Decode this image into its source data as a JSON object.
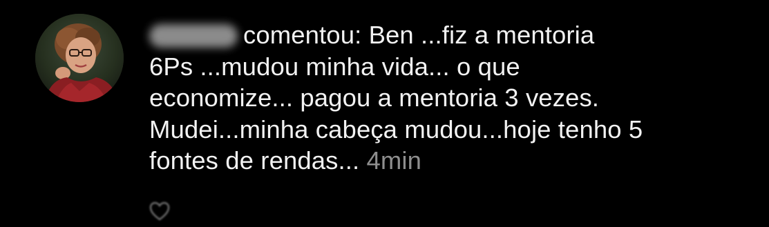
{
  "notification": {
    "username_blurred": "",
    "comment_lines": [
      "comentou: Ben ...fiz a mentoria",
      "6Ps ...mudou minha vida... o que",
      "economize... pagou a mentoria 3 vezes.",
      "Mudei...minha cabeça mudou...hoje tenho 5",
      "fontes de rendas..."
    ],
    "timestamp": "4min"
  },
  "icons": {
    "avatar": "profile-photo",
    "like": "heart-outline-icon"
  },
  "colors": {
    "background": "#000000",
    "text": "#f2f2f2",
    "timestamp": "#8e8e8e"
  }
}
